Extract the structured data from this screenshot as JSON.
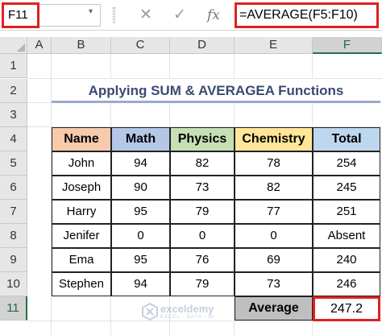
{
  "formula_bar": {
    "name_box": "F11",
    "name_box_dropdown": "▾",
    "cancel_icon": "✕",
    "enter_icon": "✓",
    "fx_label": "fx",
    "formula": "=AVERAGE(F5:F10)"
  },
  "columns": [
    "A",
    "B",
    "C",
    "D",
    "E",
    "F"
  ],
  "rows": [
    "1",
    "2",
    "3",
    "4",
    "5",
    "6",
    "7",
    "8",
    "9",
    "10",
    "11"
  ],
  "selected_cell": "F11",
  "title": "Applying SUM & AVERAGEA Functions",
  "table": {
    "headers": [
      "Name",
      "Math",
      "Physics",
      "Chemistry",
      "Total"
    ],
    "header_colors": [
      "#f7caac",
      "#b4c7e7",
      "#c5e0b4",
      "#ffe699",
      "#bdd7ee"
    ],
    "rows": [
      [
        "John",
        "94",
        "82",
        "78",
        "254"
      ],
      [
        "Joseph",
        "90",
        "73",
        "82",
        "245"
      ],
      [
        "Harry",
        "95",
        "79",
        "77",
        "251"
      ],
      [
        "Jenifer",
        "0",
        "0",
        "0",
        "Absent"
      ],
      [
        "Ema",
        "95",
        "76",
        "69",
        "240"
      ],
      [
        "Stephen",
        "94",
        "79",
        "73",
        "246"
      ]
    ]
  },
  "average": {
    "label": "Average",
    "value": "247.2"
  },
  "watermark": {
    "name": "exceldemy",
    "tagline": "EXCEL · DATA · BI"
  }
}
